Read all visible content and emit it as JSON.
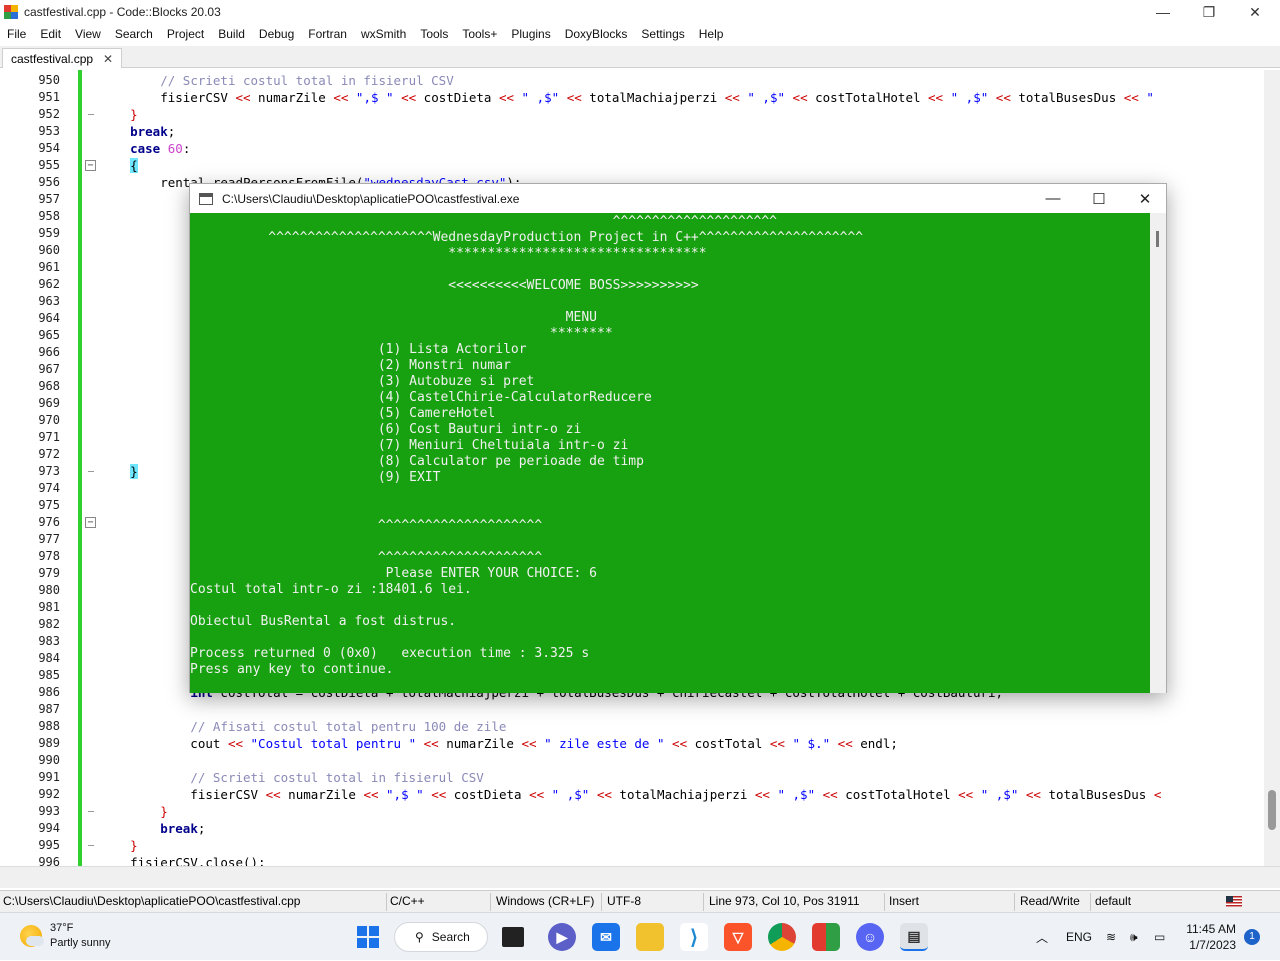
{
  "window": {
    "title": "castfestival.cpp - Code::Blocks 20.03",
    "minimize": "—",
    "maximize": "❐",
    "close": "✕"
  },
  "menu": [
    "File",
    "Edit",
    "View",
    "Search",
    "Project",
    "Build",
    "Debug",
    "Fortran",
    "wxSmith",
    "Tools",
    "Tools+",
    "Plugins",
    "DoxyBlocks",
    "Settings",
    "Help"
  ],
  "tab": {
    "label": "castfestival.cpp",
    "close": "✕"
  },
  "code_lines": [
    {
      "n": "950",
      "html": "        <span class='cm'>// Scrieti costul total in fisierul CSV</span>"
    },
    {
      "n": "951",
      "html": "        fisierCSV <span class='op'>&lt;&lt;</span> numarZile <span class='op'>&lt;&lt;</span> <span class='st'>\",$ \"</span> <span class='op'>&lt;&lt;</span> costDieta <span class='op'>&lt;&lt;</span> <span class='st'>\" ,$\"</span> <span class='op'>&lt;&lt;</span> totalMachiajperzi <span class='op'>&lt;&lt;</span> <span class='st'>\" ,$\"</span> <span class='op'>&lt;&lt;</span> costTotalHotel <span class='op'>&lt;&lt;</span> <span class='st'>\" ,$\"</span> <span class='op'>&lt;&lt;</span> totalBusesDus <span class='op'>&lt;&lt;</span> <span class='st'>\"</span>"
    },
    {
      "n": "952",
      "html": "    <span class='brace'>}</span>"
    },
    {
      "n": "953",
      "html": "    <span class='kw'>break</span>;"
    },
    {
      "n": "954",
      "html": "    <span class='kw'>case</span> <span class='num'>60</span>:"
    },
    {
      "n": "955",
      "html": "    <span class='hlbrace'>{</span>"
    },
    {
      "n": "956",
      "html": "        rental.readPersonsFromFile(<span class='st'>\"wednesdayCast.csv\"</span>);"
    },
    {
      "n": "957",
      "html": ""
    },
    {
      "n": "958",
      "html": ""
    },
    {
      "n": "959",
      "html": ""
    },
    {
      "n": "960",
      "html": ""
    },
    {
      "n": "961",
      "html": ""
    },
    {
      "n": "962",
      "html": ""
    },
    {
      "n": "963",
      "html": ""
    },
    {
      "n": "964",
      "html": ""
    },
    {
      "n": "965",
      "html": ""
    },
    {
      "n": "966",
      "html": ""
    },
    {
      "n": "967",
      "html": ""
    },
    {
      "n": "968",
      "html": ""
    },
    {
      "n": "969",
      "html": ""
    },
    {
      "n": "970",
      "html": ""
    },
    {
      "n": "971",
      "html": ""
    },
    {
      "n": "972",
      "html": "                                                                                                            esDus <span class='op'>&lt;&lt;</span> <span class='st'>\"</span>"
    },
    {
      "n": "973",
      "html": "    <span class='hlbrace'>}</span>"
    },
    {
      "n": "974",
      "html": ""
    },
    {
      "n": "975",
      "html": ""
    },
    {
      "n": "976",
      "html": ""
    },
    {
      "n": "977",
      "html": ""
    },
    {
      "n": "978",
      "html": ""
    },
    {
      "n": "979",
      "html": ""
    },
    {
      "n": "980",
      "html": ""
    },
    {
      "n": "981",
      "html": ""
    },
    {
      "n": "982",
      "html": ""
    },
    {
      "n": "983",
      "html": ""
    },
    {
      "n": "984",
      "html": ""
    },
    {
      "n": "985",
      "html": ""
    },
    {
      "n": "986",
      "html": "            <span class='kw'>int</span> costTotal = costDieta + totalMachiajperzi + totalBusesDus + chiriecastel + costTotalHotel + costBauturi;"
    },
    {
      "n": "987",
      "html": ""
    },
    {
      "n": "988",
      "html": "            <span class='cm'>// Afisati costul total pentru 100 de zile</span>"
    },
    {
      "n": "989",
      "html": "            cout <span class='op'>&lt;&lt;</span> <span class='st'>\"Costul total pentru \"</span> <span class='op'>&lt;&lt;</span> numarZile <span class='op'>&lt;&lt;</span> <span class='st'>\" zile este de \"</span> <span class='op'>&lt;&lt;</span> costTotal <span class='op'>&lt;&lt;</span> <span class='st'>\" $.\"</span> <span class='op'>&lt;&lt;</span> endl;"
    },
    {
      "n": "990",
      "html": ""
    },
    {
      "n": "991",
      "html": "            <span class='cm'>// Scrieti costul total in fisierul CSV</span>"
    },
    {
      "n": "992",
      "html": "            fisierCSV <span class='op'>&lt;&lt;</span> numarZile <span class='op'>&lt;&lt;</span> <span class='st'>\",$ \"</span> <span class='op'>&lt;&lt;</span> costDieta <span class='op'>&lt;&lt;</span> <span class='st'>\" ,$\"</span> <span class='op'>&lt;&lt;</span> totalMachiajperzi <span class='op'>&lt;&lt;</span> <span class='st'>\" ,$\"</span> <span class='op'>&lt;&lt;</span> costTotalHotel <span class='op'>&lt;&lt;</span> <span class='st'>\" ,$\"</span> <span class='op'>&lt;&lt;</span> totalBusesDus <span class='op'>&lt;</span>"
    },
    {
      "n": "993",
      "html": "        <span class='brace'>}</span>"
    },
    {
      "n": "994",
      "html": "        <span class='kw'>break</span>;"
    },
    {
      "n": "995",
      "html": "    <span class='brace'>}</span>"
    },
    {
      "n": "996",
      "html": "    fisierCSV.close();"
    }
  ],
  "console": {
    "title": "C:\\Users\\Claudiu\\Desktop\\aplicatiePOO\\castfestival.exe",
    "lines": [
      "                                                      ^^^^^^^^^^^^^^^^^^^^^",
      "          ^^^^^^^^^^^^^^^^^^^^^WednesdayProduction Project in C++^^^^^^^^^^^^^^^^^^^^^",
      "                                 *********************************",
      "",
      "                                 <<<<<<<<<<WELCOME BOSS>>>>>>>>>>",
      "",
      "                                                MENU",
      "                                              ********",
      "                        (1) Lista Actorilor",
      "                        (2) Monstri numar",
      "                        (3) Autobuze si pret",
      "                        (4) CastelChirie-CalculatorReducere",
      "                        (5) CamereHotel",
      "                        (6) Cost Bauturi intr-o zi",
      "                        (7) Meniuri Cheltuiala intr-o zi",
      "                        (8) Calculator pe perioade de timp",
      "                        (9) EXIT",
      "",
      "",
      "                        ^^^^^^^^^^^^^^^^^^^^^",
      "",
      "                        ^^^^^^^^^^^^^^^^^^^^^",
      "                         Please ENTER YOUR CHOICE: 6",
      "Costul total intr-o zi :18401.6 lei.",
      "",
      "Obiectul BusRental a fost distrus.",
      "",
      "Process returned 0 (0x0)   execution time : 3.325 s",
      "Press any key to continue."
    ]
  },
  "status": {
    "path": "C:\\Users\\Claudiu\\Desktop\\aplicatiePOO\\castfestival.cpp",
    "language": "C/C++",
    "eol": "Windows (CR+LF)",
    "encoding": "UTF-8",
    "position": "Line 973, Col 10, Pos 31911",
    "mode": "Insert",
    "access": "Read/Write",
    "profile": "default"
  },
  "taskbar": {
    "weather_temp": "37°F",
    "weather_desc": "Partly sunny",
    "search_label": "Search",
    "lang": "ENG",
    "time": "11:45 AM",
    "date": "1/7/2023",
    "notif_count": "1"
  },
  "colors": {
    "console_bg": "#17a00f",
    "change_bar": "#2ed12e",
    "brace_highlight": "#6fe6ff"
  }
}
